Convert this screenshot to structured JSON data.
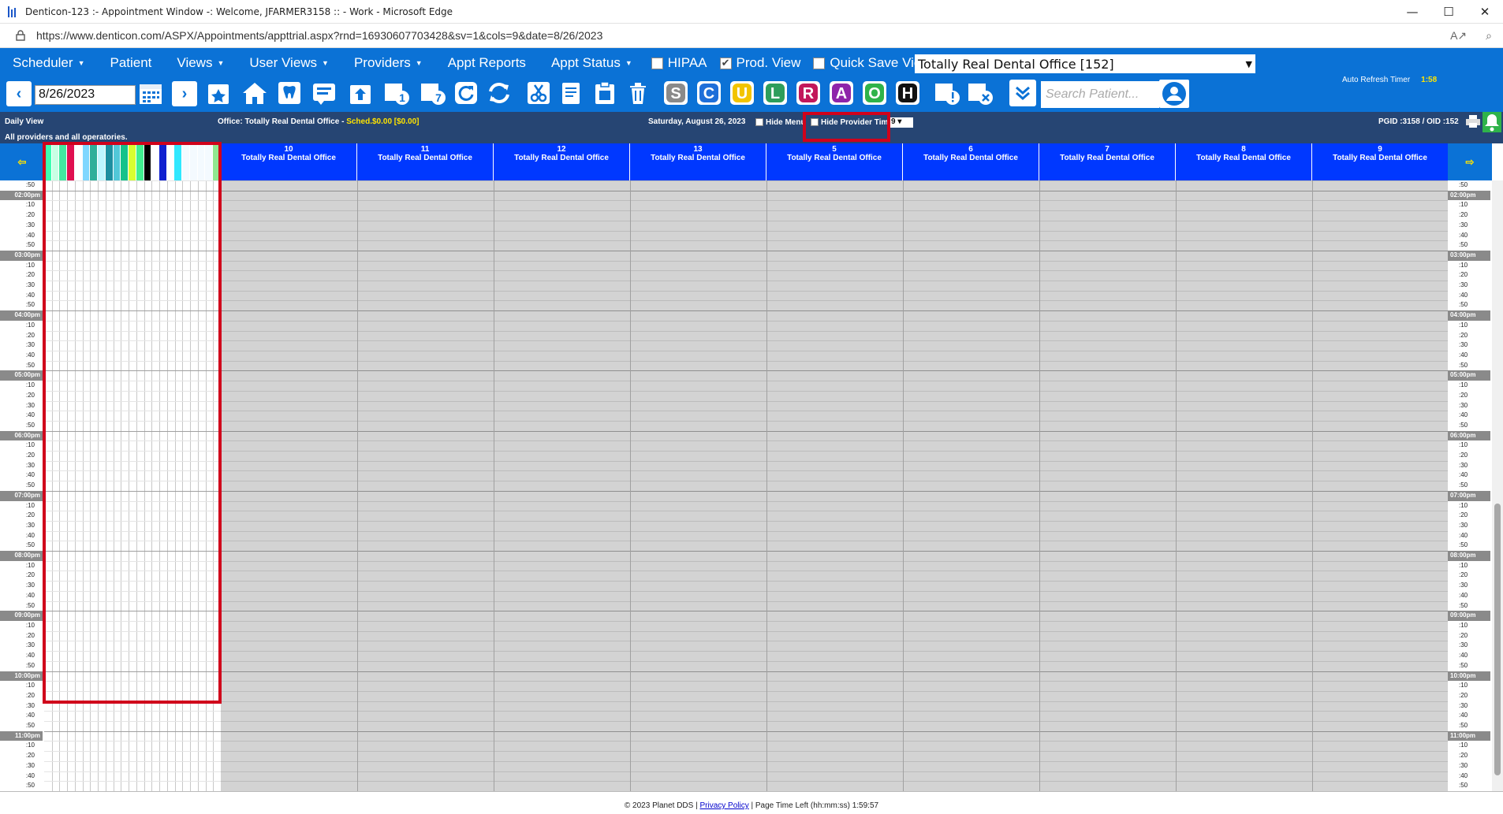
{
  "window": {
    "title": "Denticon-123 :- Appointment Window -: Welcome, JFARMER3158 :: - Work - Microsoft Edge",
    "minimize": "—",
    "maximize": "☐",
    "close": "✕"
  },
  "address": {
    "url": "https://www.denticon.com/ASPX/Appointments/appttrial.aspx?rnd=16930607703428&sv=1&cols=9&date=8/26/2023"
  },
  "menu": {
    "items": [
      "Scheduler",
      "Patient",
      "Views",
      "User Views",
      "Providers",
      "Appt Reports",
      "Appt Status"
    ],
    "hipaa_label": "HIPAA",
    "prodview_label": "Prod. View",
    "quicksave_label": "Quick Save View",
    "office_select": "Totally Real Dental Office [152]"
  },
  "toolbar": {
    "date_value": "8/26/2023",
    "search_placeholder": "Search Patient...",
    "letters": [
      "S",
      "C",
      "U",
      "L",
      "R",
      "A",
      "O",
      "H"
    ],
    "letter_colors": [
      "#8a8a8a",
      "#1e6fd9",
      "#f2c400",
      "#2e9e5b",
      "#c2185b",
      "#8e24aa",
      "#2fb34a",
      "#111111"
    ],
    "refresh_label": "Auto Refresh Timer",
    "refresh_value": "1:58"
  },
  "info": {
    "view_label": "Daily View",
    "scope_label": "All providers and all operatories.",
    "office_label": "Office: Totally Real Dental Office - ",
    "sched_label": "Sched.$0.00 [$0.00]",
    "date_label": "Saturday, August 26, 2023",
    "hide_menu_label": "Hide Menu",
    "hide_provider_label": "Hide Provider Time",
    "cols_value": "9",
    "ids_label": "PGID :3158  /  OID :152"
  },
  "columns": [
    {
      "num": "10",
      "name": "Totally Real Dental Office"
    },
    {
      "num": "11",
      "name": "Totally Real Dental Office"
    },
    {
      "num": "12",
      "name": "Totally Real Dental Office"
    },
    {
      "num": "13",
      "name": "Totally Real Dental Office"
    },
    {
      "num": "5",
      "name": "Totally Real Dental Office"
    },
    {
      "num": "6",
      "name": "Totally Real Dental Office"
    },
    {
      "num": "7",
      "name": "Totally Real Dental Office"
    },
    {
      "num": "8",
      "name": "Totally Real Dental Office"
    },
    {
      "num": "9",
      "name": "Totally Real Dental Office"
    }
  ],
  "provider_stripe_colors": [
    "#3dffb0",
    "#c8ffe4",
    "#43e8a0",
    "#e01050",
    "#ffffff",
    "#7fd7ff",
    "#2faf9a",
    "#bff6ff",
    "#1d8fa0",
    "#52c8d8",
    "#15c28a",
    "#d8ff30",
    "#40f090",
    "#000000",
    "#ffffff",
    "#1020d0",
    "#ffffff",
    "#30e8ff",
    "#f4faff",
    "#f4faff",
    "#f4faff",
    "#f4faff",
    "#90e890"
  ],
  "times": [
    {
      "label": ":50",
      "hour": false
    },
    {
      "label": "02:00pm",
      "hour": true
    },
    {
      "label": ":10",
      "hour": false
    },
    {
      "label": ":20",
      "hour": false
    },
    {
      "label": ":30",
      "hour": false
    },
    {
      "label": ":40",
      "hour": false
    },
    {
      "label": ":50",
      "hour": false
    },
    {
      "label": "03:00pm",
      "hour": true
    },
    {
      "label": ":10",
      "hour": false
    },
    {
      "label": ":20",
      "hour": false
    },
    {
      "label": ":30",
      "hour": false
    },
    {
      "label": ":40",
      "hour": false
    },
    {
      "label": ":50",
      "hour": false
    },
    {
      "label": "04:00pm",
      "hour": true
    },
    {
      "label": ":10",
      "hour": false
    },
    {
      "label": ":20",
      "hour": false
    },
    {
      "label": ":30",
      "hour": false
    },
    {
      "label": ":40",
      "hour": false
    },
    {
      "label": ":50",
      "hour": false
    },
    {
      "label": "05:00pm",
      "hour": true
    },
    {
      "label": ":10",
      "hour": false
    },
    {
      "label": ":20",
      "hour": false
    },
    {
      "label": ":30",
      "hour": false
    },
    {
      "label": ":40",
      "hour": false
    },
    {
      "label": ":50",
      "hour": false
    },
    {
      "label": "06:00pm",
      "hour": true
    },
    {
      "label": ":10",
      "hour": false
    },
    {
      "label": ":20",
      "hour": false
    },
    {
      "label": ":30",
      "hour": false
    },
    {
      "label": ":40",
      "hour": false
    },
    {
      "label": ":50",
      "hour": false
    },
    {
      "label": "07:00pm",
      "hour": true
    },
    {
      "label": ":10",
      "hour": false
    },
    {
      "label": ":20",
      "hour": false
    },
    {
      "label": ":30",
      "hour": false
    },
    {
      "label": ":40",
      "hour": false
    },
    {
      "label": ":50",
      "hour": false
    },
    {
      "label": "08:00pm",
      "hour": true
    },
    {
      "label": ":10",
      "hour": false
    },
    {
      "label": ":20",
      "hour": false
    },
    {
      "label": ":30",
      "hour": false
    },
    {
      "label": ":40",
      "hour": false
    },
    {
      "label": ":50",
      "hour": false
    },
    {
      "label": "09:00pm",
      "hour": true
    },
    {
      "label": ":10",
      "hour": false
    },
    {
      "label": ":20",
      "hour": false
    },
    {
      "label": ":30",
      "hour": false
    },
    {
      "label": ":40",
      "hour": false
    },
    {
      "label": ":50",
      "hour": false
    },
    {
      "label": "10:00pm",
      "hour": true
    },
    {
      "label": ":10",
      "hour": false
    },
    {
      "label": ":20",
      "hour": false
    },
    {
      "label": ":30",
      "hour": false
    },
    {
      "label": ":40",
      "hour": false
    },
    {
      "label": ":50",
      "hour": false
    },
    {
      "label": "11:00pm",
      "hour": true
    },
    {
      "label": ":10",
      "hour": false
    },
    {
      "label": ":20",
      "hour": false
    },
    {
      "label": ":30",
      "hour": false
    },
    {
      "label": ":40",
      "hour": false
    },
    {
      "label": ":50",
      "hour": false
    }
  ],
  "footer": {
    "copyright": "© 2023 Planet DDS",
    "privacy": "Privacy Policy",
    "time_left": "Page Time Left (hh:mm:ss) 1:59:57"
  },
  "colors": {
    "brand_blue": "#0b72d6",
    "header_navy": "#264573",
    "operatory_blue": "#0038ff",
    "highlight_red": "#d0021b",
    "sched_yellow": "#ffe400"
  }
}
